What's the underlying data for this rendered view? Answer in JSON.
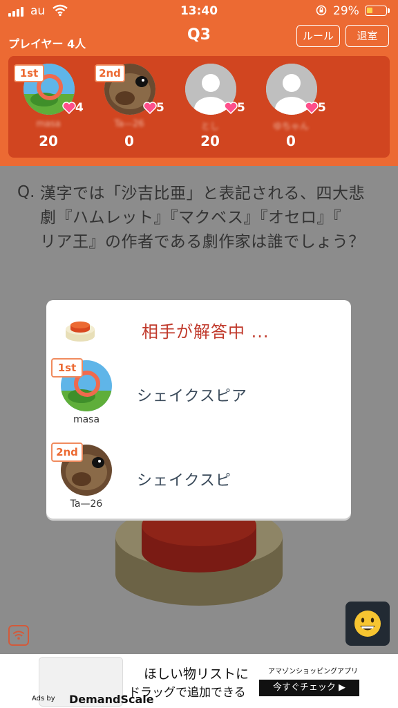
{
  "status_bar": {
    "carrier": "au",
    "time": "13:40",
    "battery_percent": "29%",
    "battery_level": 0.29
  },
  "header": {
    "players_label": "プレイヤー 4人",
    "question_number": "Q3",
    "rules_button": "ルール",
    "leave_button": "退室"
  },
  "players": [
    {
      "rank": "1st",
      "hearts": "4",
      "name": "masa",
      "score": "20"
    },
    {
      "rank": "2nd",
      "hearts": "5",
      "name": "Ta—26",
      "score": "0"
    },
    {
      "rank": "",
      "hearts": "5",
      "name": "とし",
      "score": "20"
    },
    {
      "rank": "",
      "hearts": "5",
      "name": "ゆちゃん",
      "score": "0"
    }
  ],
  "question": {
    "prefix": "Q.",
    "line1": "漢字では「沙吉比亜」と表記される、四大悲",
    "line2": "劇『ハムレット』『マクベス』『オセロ』『",
    "line3": "リア王』の作者である劇作家は誰でしょう？"
  },
  "modal": {
    "status": "相手が解答中 ...",
    "answers": [
      {
        "rank": "1st",
        "name": "masa",
        "answer": "シェイクスピア"
      },
      {
        "rank": "2nd",
        "name": "Ta—26",
        "answer": "シェイクスピ"
      }
    ]
  },
  "ad": {
    "line1": "ほしい物リストに",
    "line2": "ドラッグで追加できる",
    "tagline": "アマゾンショッピングアプリ",
    "cta": "今すぐチェック ▶",
    "ads_by": "Ads by",
    "brand": "DemandScale"
  },
  "colors": {
    "header": "#ec6a33",
    "panel": "#d14520",
    "heart": "#ff4f8b",
    "answer_status": "#c0392b"
  },
  "icons": [
    "signal-icon",
    "wifi-icon",
    "lock-rotation-icon",
    "battery-icon",
    "heart-icon",
    "buzzer-icon",
    "grinning-emoji-icon"
  ]
}
